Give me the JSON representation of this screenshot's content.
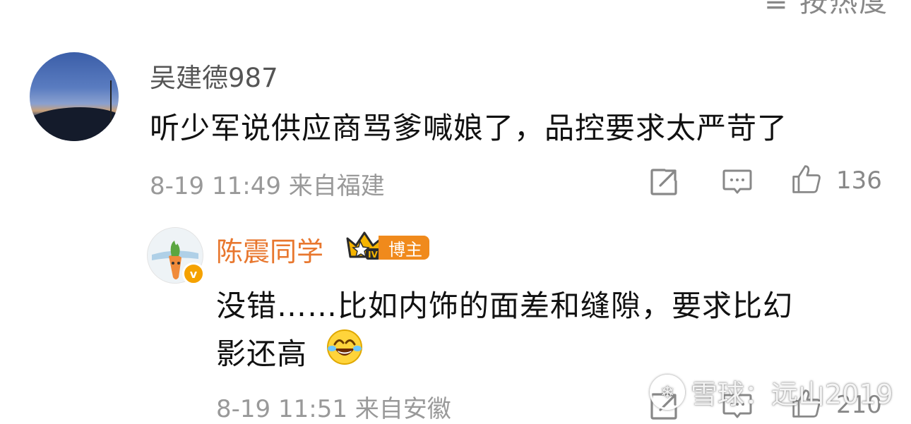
{
  "header": {
    "sort_label": "≡ 按热度"
  },
  "comment": {
    "username": "吴建德987",
    "text": "听少军说供应商骂爹喊娘了，品控要求太严苛了",
    "time": "8-19 11:49",
    "location": "来自福建",
    "like_count": "136"
  },
  "reply": {
    "username": "陈震同学",
    "badge_label": "博主",
    "text_line1": "没错……比如内饰的面差和缝隙，要求比幻",
    "text_line2": "影还高",
    "time": "8-19 11:51",
    "location": "来自安徽",
    "like_count": "210",
    "verified_mark": "v"
  },
  "watermark": {
    "text": "雪球：远山2019"
  },
  "icons": {
    "share": "share-icon",
    "comment": "comment-icon",
    "like": "like-icon",
    "emoji": "laughing-crying-emoji"
  },
  "colors": {
    "username_main": "#555555",
    "username_blogger": "#e8772e",
    "badge": "#f08a1c",
    "meta": "#999999"
  }
}
